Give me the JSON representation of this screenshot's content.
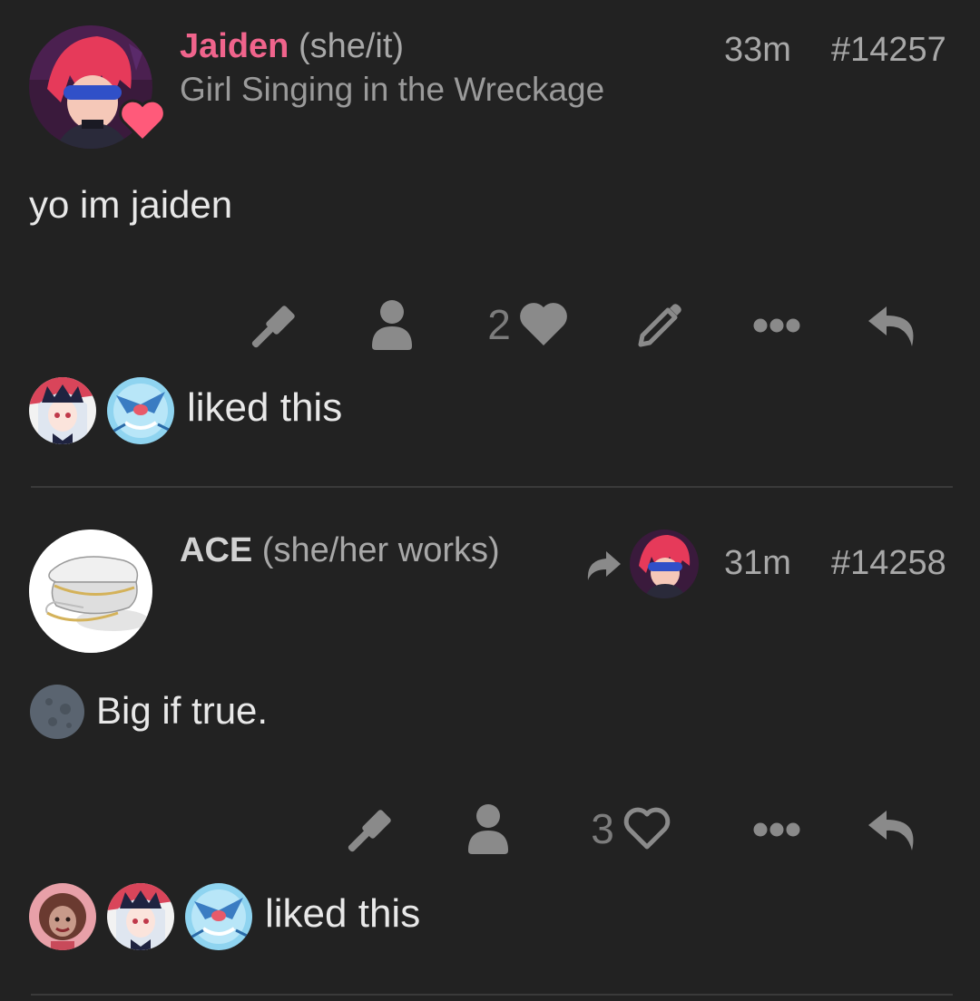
{
  "posts": [
    {
      "username": "Jaiden",
      "pronouns": "(she/it)",
      "subtitle": "Girl Singing in the Wreckage",
      "time": "33m",
      "post_id": "#14257",
      "body": "yo im jaiden",
      "like_count": "2",
      "liked_text": "liked this",
      "liked_by_count": 2,
      "liked": true
    },
    {
      "username": "ACE",
      "pronouns": "(she/her works)",
      "time": "31m",
      "post_id": "#14258",
      "body": "Big if true.",
      "like_count": "3",
      "liked_text": "liked this",
      "liked_by_count": 3,
      "liked": false
    }
  ],
  "colors": {
    "background": "#222222",
    "username_accent": "#f0648c",
    "icon": "#8a8a8a",
    "divider": "#3a3a3a"
  },
  "icons": [
    "hammer-icon",
    "user-icon",
    "heart-icon",
    "pencil-icon",
    "more-icon",
    "reply-icon",
    "repost-icon",
    "moon-icon"
  ]
}
